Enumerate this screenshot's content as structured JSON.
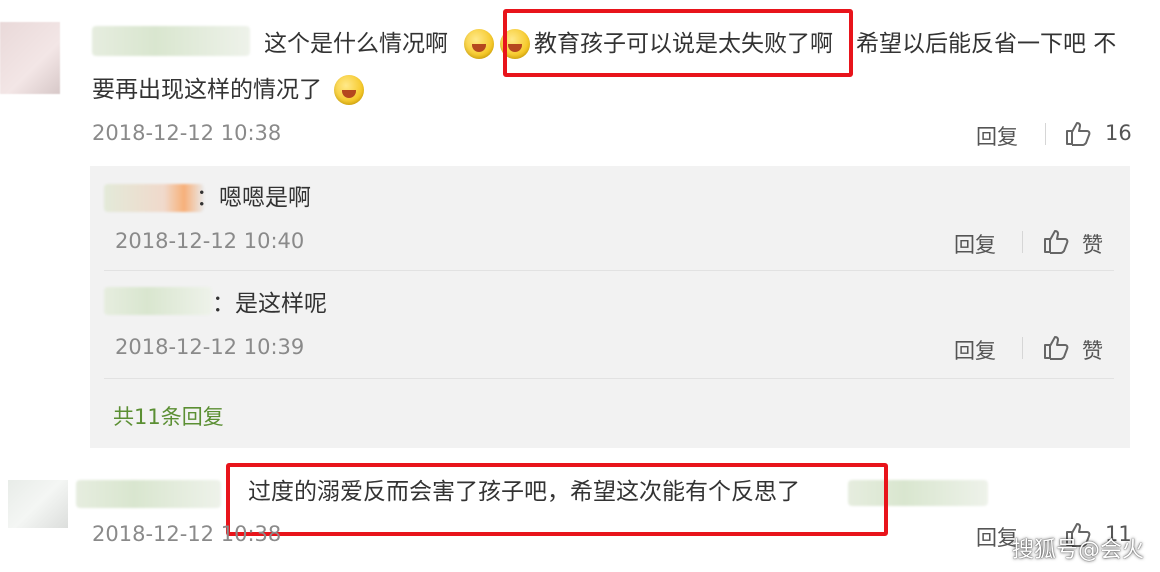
{
  "comment1": {
    "text_a": "这个是什么情况啊",
    "text_b": "教育孩子可以说是太失败了啊",
    "text_c": "希望以后能反省一下吧 不",
    "text_d": "要再出现这样的情况了",
    "time": "2018-12-12 10:38",
    "reply_label": "回复",
    "likes": "16"
  },
  "replies": [
    {
      "text": "：嗯嗯是啊",
      "time": "2018-12-12 10:40",
      "reply_label": "回复",
      "like_label": "赞"
    },
    {
      "text": "：是这样呢",
      "time": "2018-12-12 10:39",
      "reply_label": "回复",
      "like_label": "赞"
    }
  ],
  "more_replies": "共11条回复",
  "comment2": {
    "text": "过度的溺爱反而会害了孩子吧，希望这次能有个反思了",
    "time": "2018-12-12 10:38",
    "reply_label": "回复",
    "likes": "11"
  },
  "watermark": "搜狐号@会火",
  "colors": {
    "highlight": "#e8141b",
    "link_green": "#5b8f33",
    "reply_bg": "#f2f2f2"
  },
  "icons": [
    "emoji-laugh-cry-icon",
    "thumb-up-icon"
  ]
}
